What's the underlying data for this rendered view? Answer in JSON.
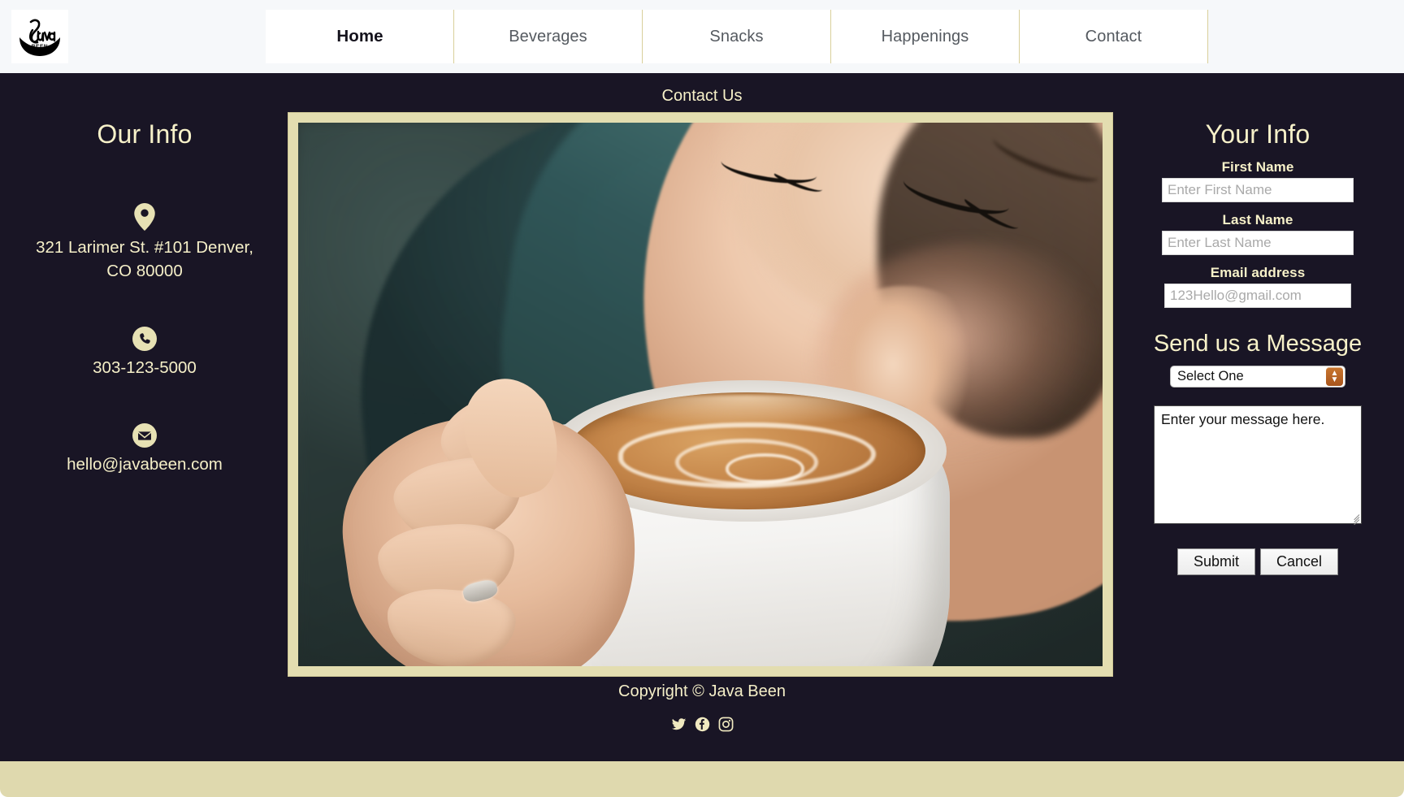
{
  "header": {
    "logo": {
      "name": "java-been-logo",
      "script_text": "Java",
      "sub_text": "BEEN"
    },
    "nav_items": [
      {
        "label": "Home",
        "active": true
      },
      {
        "label": "Beverages",
        "active": false
      },
      {
        "label": "Snacks",
        "active": false
      },
      {
        "label": "Happenings",
        "active": false
      },
      {
        "label": "Contact",
        "active": false
      }
    ]
  },
  "main": {
    "section_title": "Contact Us",
    "left": {
      "heading": "Our Info",
      "address": {
        "icon": "map-marker-icon",
        "text": "321 Larimer St. #101 Denver, CO 80000"
      },
      "phone": {
        "icon": "phone-icon",
        "text": "303-123-5000"
      },
      "email": {
        "icon": "envelope-icon",
        "text": "hello@javabeen.com"
      }
    },
    "photo": {
      "alt": "Woman sipping a latte from a white cup",
      "frame_color": "#e3ddb0"
    },
    "right": {
      "heading": "Your Info",
      "fields": [
        {
          "label": "First Name",
          "placeholder": "Enter First Name",
          "value": ""
        },
        {
          "label": "Last Name",
          "placeholder": "Enter Last Name",
          "value": ""
        },
        {
          "label": "Email address",
          "placeholder": "123Hello@gmail.com",
          "value": ""
        }
      ],
      "message_heading": "Send us a Message",
      "select": {
        "selected": "Select One",
        "options": [
          "Select One"
        ]
      },
      "textarea_value": "Enter your message here.",
      "buttons": {
        "submit": "Submit",
        "cancel": "Cancel"
      }
    }
  },
  "footer": {
    "copyright": "Copyright © Java Been",
    "socials": [
      {
        "name": "twitter-icon"
      },
      {
        "name": "facebook-icon"
      },
      {
        "name": "instagram-icon"
      }
    ]
  },
  "theme": {
    "dark_bg": "#191525",
    "cream": "#f5efc8",
    "khaki": "#dfd9ae",
    "accent_orange": "#b25e21"
  }
}
